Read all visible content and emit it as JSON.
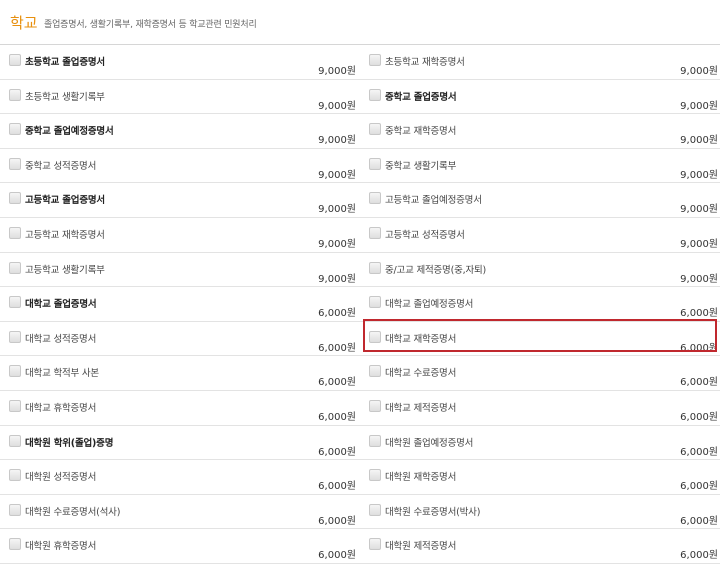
{
  "header": {
    "title": "학교",
    "description": "졸업증명서, 생활기록부, 재학증명서 등 학교관련 민원처리"
  },
  "rows": [
    [
      {
        "label": "초등학교 졸업증명서",
        "price": "9,000원",
        "bold": true
      },
      {
        "label": "초등학교 재학증명서",
        "price": "9,000원",
        "bold": false
      }
    ],
    [
      {
        "label": "초등학교 생활기록부",
        "price": "9,000원",
        "bold": false
      },
      {
        "label": "중학교 졸업증명서",
        "price": "9,000원",
        "bold": true
      }
    ],
    [
      {
        "label": "중학교 졸업예정증명서",
        "price": "9,000원",
        "bold": true
      },
      {
        "label": "중학교 재학증명서",
        "price": "9,000원",
        "bold": false
      }
    ],
    [
      {
        "label": "중학교 성적증명서",
        "price": "9,000원",
        "bold": false
      },
      {
        "label": "중학교 생활기록부",
        "price": "9,000원",
        "bold": false
      }
    ],
    [
      {
        "label": "고등학교 졸업증명서",
        "price": "9,000원",
        "bold": true
      },
      {
        "label": "고등학교 졸업예정증명서",
        "price": "9,000원",
        "bold": false
      }
    ],
    [
      {
        "label": "고등학교 재학증명서",
        "price": "9,000원",
        "bold": false
      },
      {
        "label": "고등학교 성적증명서",
        "price": "9,000원",
        "bold": false
      }
    ],
    [
      {
        "label": "고등학교 생활기록부",
        "price": "9,000원",
        "bold": false
      },
      {
        "label": "중/고교 제적증명(중,자퇴)",
        "price": "9,000원",
        "bold": false
      }
    ],
    [
      {
        "label": "대학교 졸업증명서",
        "price": "6,000원",
        "bold": true
      },
      {
        "label": "대학교 졸업예정증명서",
        "price": "6,000원",
        "bold": false
      }
    ],
    [
      {
        "label": "대학교 성적증명서",
        "price": "6,000원",
        "bold": false
      },
      {
        "label": "대학교 재학증명서",
        "price": "6,000원",
        "bold": false
      }
    ],
    [
      {
        "label": "대학교 학적부 사본",
        "price": "6,000원",
        "bold": false
      },
      {
        "label": "대학교 수료증명서",
        "price": "6,000원",
        "bold": false
      }
    ],
    [
      {
        "label": "대학교 휴학증명서",
        "price": "6,000원",
        "bold": false
      },
      {
        "label": "대학교 제적증명서",
        "price": "6,000원",
        "bold": false
      }
    ],
    [
      {
        "label": "대학원 학위(졸업)증명",
        "price": "6,000원",
        "bold": true
      },
      {
        "label": "대학원 졸업예정증명서",
        "price": "6,000원",
        "bold": false
      }
    ],
    [
      {
        "label": "대학원 성적증명서",
        "price": "6,000원",
        "bold": false
      },
      {
        "label": "대학원 재학증명서",
        "price": "6,000원",
        "bold": false
      }
    ],
    [
      {
        "label": "대학원 수료증명서(석사)",
        "price": "6,000원",
        "bold": false
      },
      {
        "label": "대학원 수료증명서(박사)",
        "price": "6,000원",
        "bold": false
      }
    ],
    [
      {
        "label": "대학원 휴학증명서",
        "price": "6,000원",
        "bold": false
      },
      {
        "label": "대학원 제적증명서",
        "price": "6,000원",
        "bold": false
      }
    ]
  ],
  "highlight_color": "#c0282e",
  "accent_color": "#e8900e"
}
